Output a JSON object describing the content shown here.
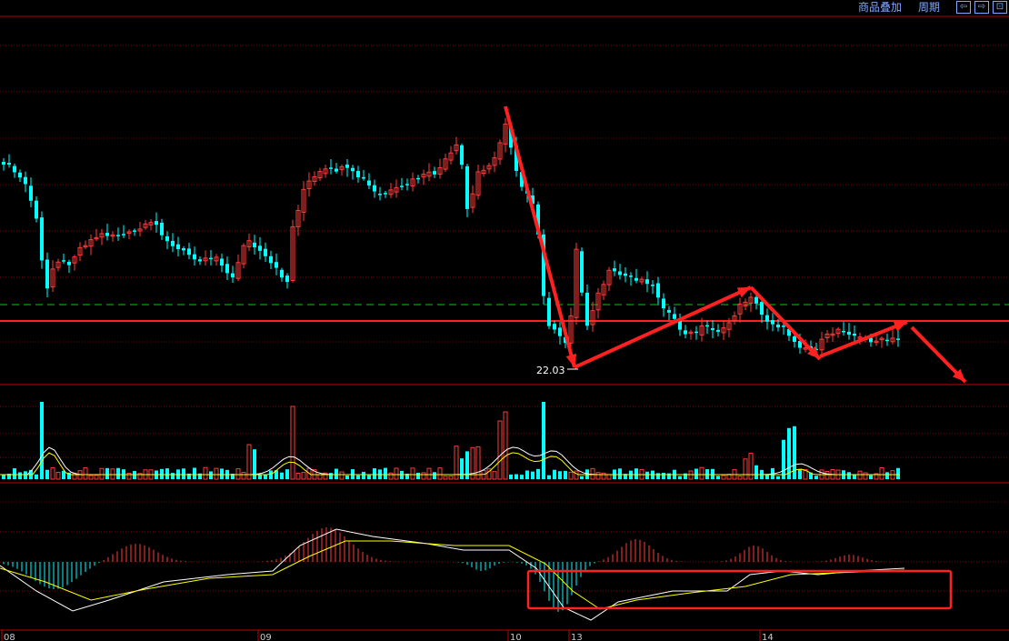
{
  "toolbar": {
    "overlay_label": "商品叠加",
    "period_label": "周期",
    "btn_back": "⇦",
    "btn_forward": "⇨",
    "btn_expand": "⊡"
  },
  "chart_data": [
    {
      "type": "candlestick",
      "panel": "price",
      "low_marker": "22.03",
      "x_dates": [
        "08",
        "09",
        "10",
        "13",
        "14"
      ],
      "grid": true,
      "colors": {
        "up": "#ff3b3b",
        "down": "#00ffff",
        "grid": "#7a0000",
        "reference": "#ff2020",
        "dashed": "#00cc00"
      },
      "annotations": [
        "red arrow down from peak",
        "red arrow up",
        "red arrow down",
        "red arrow up",
        "red arrow down"
      ]
    },
    {
      "type": "bar",
      "panel": "volume",
      "ma_lines": [
        "white",
        "yellow"
      ],
      "colors": {
        "up": "#ff3b3b",
        "down": "#00ffff"
      }
    },
    {
      "type": "bar",
      "panel": "macd",
      "lines": [
        "DIF (white)",
        "DEA (yellow)"
      ],
      "highlight_box": "red rectangle around recent MACD lines",
      "colors": {
        "positive": "#ff3b3b",
        "negative": "#00ffff"
      }
    }
  ]
}
